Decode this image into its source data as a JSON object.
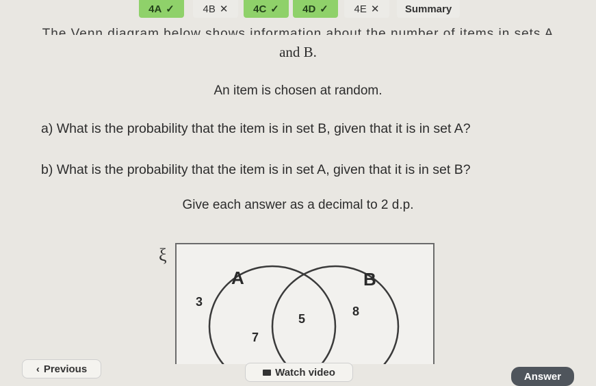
{
  "tabs": [
    {
      "label": "4A",
      "status": "correct",
      "mark": "✓"
    },
    {
      "label": "4B",
      "status": "wrong",
      "mark": "✕"
    },
    {
      "label": "4C",
      "status": "correct",
      "mark": "✓"
    },
    {
      "label": "4D",
      "status": "correct",
      "mark": "✓"
    },
    {
      "label": "4E",
      "status": "wrong",
      "mark": "✕"
    },
    {
      "label": "Summary",
      "status": "summary",
      "mark": ""
    }
  ],
  "question": {
    "intro_cut": "The Venn diagram below shows information about the number of items in sets A",
    "intro_end": "and B.",
    "chosen": "An item is chosen at random.",
    "part_a": "a) What is the probability that the item is in set B, given that it is in set A?",
    "part_b": "b) What is the probability that the item is in set A, given that it is in set B?",
    "instruction": "Give each answer as a decimal to 2 d.p."
  },
  "venn": {
    "universal_symbol": "ξ",
    "label_a": "A",
    "label_b": "B",
    "outside": "3",
    "a_only": "7",
    "intersection": "5",
    "b_only": "8"
  },
  "buttons": {
    "previous": "Previous",
    "watch_video": "Watch video",
    "answer": "Answer"
  },
  "colors": {
    "correct": "#8fd16a",
    "answer_button": "#4f555c"
  }
}
